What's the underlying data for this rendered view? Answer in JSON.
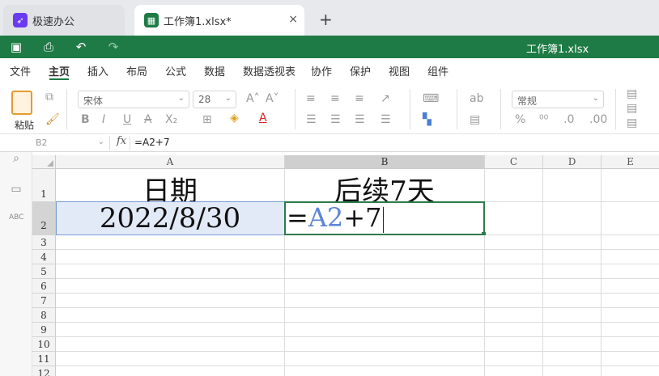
{
  "tabs": [
    {
      "label": "极速办公",
      "icon": "rocket-icon"
    },
    {
      "label": "工作簿1.xlsx*",
      "icon": "spreadsheet-icon",
      "close": "×"
    }
  ],
  "tab_add": "+",
  "window_title": "工作簿1.xlsx",
  "menu": [
    "文件",
    "主页",
    "插入",
    "布局",
    "公式",
    "数据",
    "数据透视表",
    "协作",
    "保护",
    "视图",
    "组件"
  ],
  "ribbon": {
    "paste_label": "粘贴",
    "font_family": "宋体",
    "font_size": "28",
    "number_format": "常规"
  },
  "formula_bar": {
    "cell_ref": "B2",
    "fx": "fx",
    "formula": "=A2+7"
  },
  "columns": [
    "A",
    "B",
    "C",
    "D",
    "E"
  ],
  "rows": [
    "1",
    "2",
    "3",
    "4",
    "5",
    "6",
    "7",
    "8",
    "9",
    "10",
    "11",
    "12"
  ],
  "cells": {
    "A1": "日期",
    "B1": "后续7天",
    "A2": "2022/8/30"
  },
  "edit": {
    "eq": "=",
    "ref": "A2",
    "rest": "+7"
  },
  "colors": {
    "brand_green": "#1e7b45",
    "selection_blue": "#e3eaf7",
    "reference_blue": "#5b85d6"
  }
}
